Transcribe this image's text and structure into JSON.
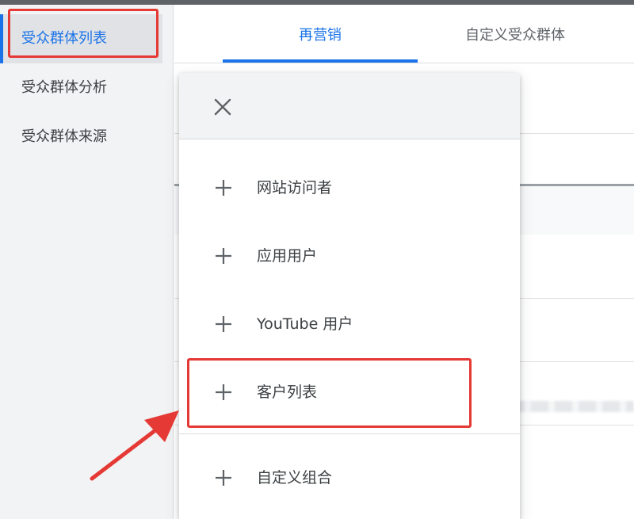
{
  "sidebar": {
    "items": [
      {
        "label": "受众群体列表",
        "active": true
      },
      {
        "label": "受众群体分析",
        "active": false
      },
      {
        "label": "受众群体来源",
        "active": false
      }
    ]
  },
  "tabs": [
    {
      "label": "再营销",
      "active": true
    },
    {
      "label": "自定义受众群体",
      "active": false
    }
  ],
  "menu": {
    "close_icon": "close-icon",
    "options": [
      {
        "label": "网站访问者",
        "icon": "plus-icon"
      },
      {
        "label": "应用用户",
        "icon": "plus-icon"
      },
      {
        "label": "YouTube 用户",
        "icon": "plus-icon"
      },
      {
        "label": "客户列表",
        "icon": "plus-icon",
        "highlighted": true
      },
      {
        "label": "自定义组合",
        "icon": "plus-icon"
      }
    ]
  },
  "colors": {
    "accent": "#1a73e8",
    "annotation": "#e53935",
    "sidebar_bg": "#f1f3f4"
  }
}
